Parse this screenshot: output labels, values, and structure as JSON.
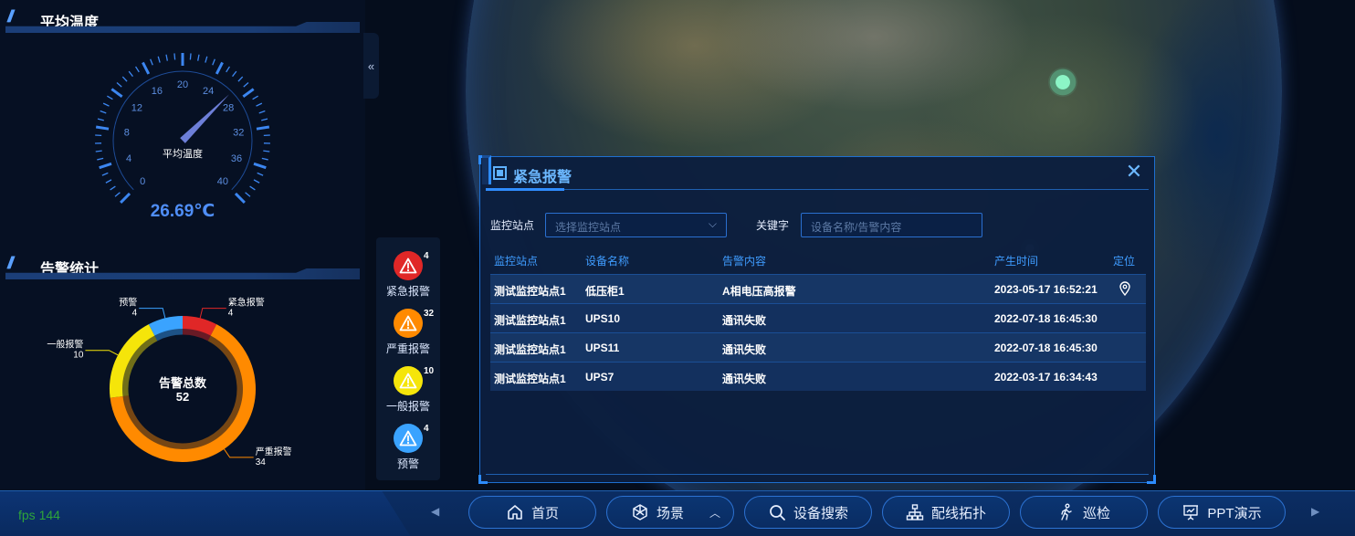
{
  "left_panel": {
    "temperature": {
      "title": "平均温度",
      "gauge_center_label": "平均温度",
      "value_text": "26.69℃",
      "value": 26.69,
      "min": 0,
      "max": 40,
      "ticks": [
        "0",
        "4",
        "8",
        "12",
        "16",
        "20",
        "24",
        "28",
        "32",
        "36",
        "40"
      ]
    },
    "alarm_stats": {
      "title": "告警统计",
      "center_label": "告警总数",
      "total": "52",
      "segments": [
        {
          "name": "紧急报警",
          "value": "4",
          "color": "#e02727"
        },
        {
          "name": "严重报警",
          "value": "34",
          "color": "#ff8a00"
        },
        {
          "name": "一般报警",
          "value": "10",
          "color": "#f5e50a"
        },
        {
          "name": "预警",
          "value": "4",
          "color": "#3aa3ff"
        }
      ]
    },
    "collapse_label": "«"
  },
  "alarm_bar": {
    "items": [
      {
        "label": "紧急报警",
        "count": "4",
        "color": "#e02727"
      },
      {
        "label": "严重报警",
        "count": "32",
        "color": "#ff8a00"
      },
      {
        "label": "一般报警",
        "count": "10",
        "color": "#f5e50a"
      },
      {
        "label": "预警",
        "count": "4",
        "color": "#3aa3ff"
      }
    ]
  },
  "dialog": {
    "title": "紧急报警",
    "close_icon": "close-icon",
    "filters": {
      "station_label": "监控站点",
      "station_placeholder": "选择监控站点",
      "keyword_label": "关键字",
      "keyword_placeholder": "设备名称/告警内容"
    },
    "columns": [
      "监控站点",
      "设备名称",
      "告警内容",
      "产生时间",
      "定位"
    ],
    "rows": [
      {
        "station": "测试监控站点1",
        "device": "低压柜1",
        "content": "A相电压高报警",
        "time": "2023-05-17 16:52:21",
        "has_location": true
      },
      {
        "station": "测试监控站点1",
        "device": "UPS10",
        "content": "通讯失败",
        "time": "2022-07-18 16:45:30",
        "has_location": false
      },
      {
        "station": "测试监控站点1",
        "device": "UPS11",
        "content": "通讯失败",
        "time": "2022-07-18 16:45:30",
        "has_location": false
      },
      {
        "station": "测试监控站点1",
        "device": "UPS7",
        "content": "通讯失败",
        "time": "2022-03-17 16:34:43",
        "has_location": false
      }
    ]
  },
  "bottom_bar": {
    "fps": "fps 144",
    "nav_prev": "◀",
    "nav_next": "▶",
    "buttons": [
      {
        "label": "首页",
        "icon": "home-icon"
      },
      {
        "label": "场景",
        "icon": "scene-icon"
      },
      {
        "label": "设备搜索",
        "icon": "search-icon"
      },
      {
        "label": "配线拓扑",
        "icon": "topology-icon"
      },
      {
        "label": "巡检",
        "icon": "walking-icon"
      },
      {
        "label": "PPT演示",
        "icon": "presentation-icon"
      }
    ]
  }
}
